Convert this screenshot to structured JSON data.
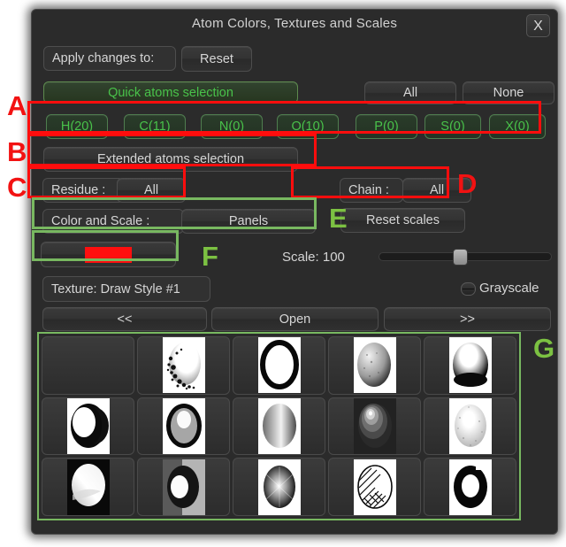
{
  "window": {
    "title": "Atom Colors, Textures and Scales",
    "close_label": "X"
  },
  "apply_row": {
    "label": "Apply changes to:",
    "reset_label": "Reset"
  },
  "quick_selection": {
    "header_label": "Quick atoms selection",
    "all_label": "All",
    "none_label": "None",
    "atoms": [
      {
        "label": "H(20)"
      },
      {
        "label": "C(11)"
      },
      {
        "label": "N(0)"
      },
      {
        "label": "O(10)"
      },
      {
        "label": "P(0)"
      },
      {
        "label": "S(0)"
      },
      {
        "label": "X(0)"
      }
    ]
  },
  "extended_selection": {
    "header_label": "Extended atoms selection",
    "residue_label": "Residue :",
    "residue_value": "All",
    "chain_label": "Chain :",
    "chain_value": "All"
  },
  "color_scale": {
    "label": "Color and Scale :",
    "mode_value": "Panels",
    "reset_scales_label": "Reset scales",
    "swatch_color": "#ff0f0f",
    "scale_label": "Scale: 100",
    "scale_value": 100,
    "scale_percent": 47
  },
  "texture": {
    "name_label": "Texture: Draw Style #1",
    "grayscale_label": "Grayscale",
    "grayscale_checked": false,
    "prev_label": "<<",
    "open_label": "Open",
    "next_label": ">>"
  },
  "thumbnails": [
    {
      "name": "empty"
    },
    {
      "name": "speckled-sphere"
    },
    {
      "name": "thick-ring-outline"
    },
    {
      "name": "rough-matte-sphere"
    },
    {
      "name": "dithered-highlight-sphere"
    },
    {
      "name": "crescent-shadow-sphere"
    },
    {
      "name": "ringed-gray-sphere"
    },
    {
      "name": "vertical-gradient-sphere"
    },
    {
      "name": "banded-glossy-sphere"
    },
    {
      "name": "grainy-glow-sphere"
    },
    {
      "name": "smooth-white-sphere"
    },
    {
      "name": "half-shadow-sphere"
    },
    {
      "name": "radial-noise-sphere"
    },
    {
      "name": "hatched-sketch-sphere"
    },
    {
      "name": "bold-black-ring"
    }
  ],
  "annotations": {
    "colors": {
      "red": "#f21212",
      "green": "#7cc142"
    },
    "letters": [
      {
        "id": "A",
        "text": "A",
        "color": "red"
      },
      {
        "id": "B",
        "text": "B",
        "color": "red"
      },
      {
        "id": "C",
        "text": "C",
        "color": "red"
      },
      {
        "id": "D",
        "text": "D",
        "color": "red"
      },
      {
        "id": "E",
        "text": "E",
        "color": "green"
      },
      {
        "id": "F",
        "text": "F",
        "color": "green"
      },
      {
        "id": "G",
        "text": "G",
        "color": "green"
      }
    ]
  }
}
